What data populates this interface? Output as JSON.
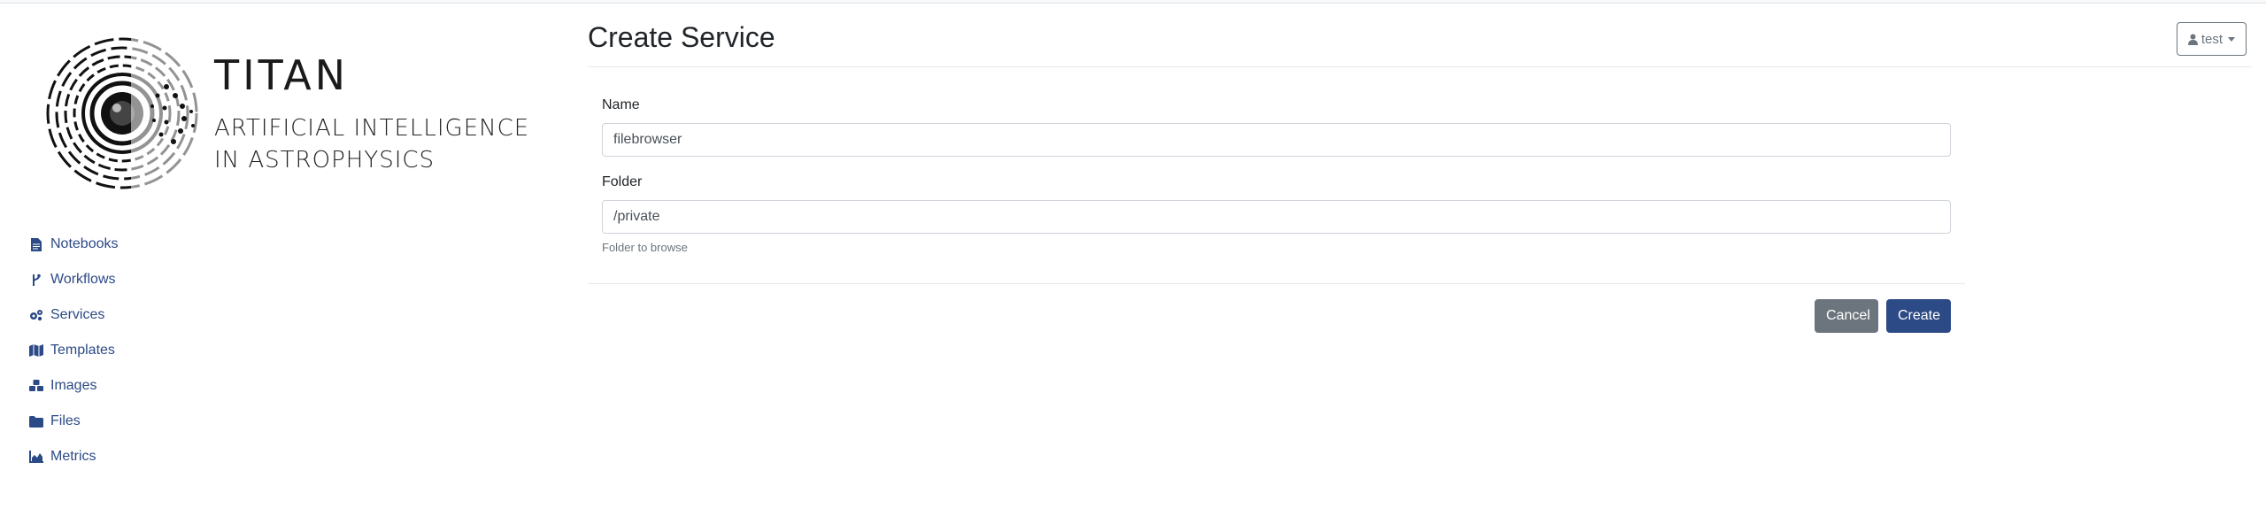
{
  "logo": {
    "title": "TITAN",
    "subtitle_line1": "ARTIFICIAL INTELLIGENCE",
    "subtitle_line2": "IN ASTROPHYSICS"
  },
  "sidebar": {
    "items": [
      {
        "label": "Notebooks",
        "icon": "file-icon"
      },
      {
        "label": "Workflows",
        "icon": "branch-icon"
      },
      {
        "label": "Services",
        "icon": "cogs-icon"
      },
      {
        "label": "Templates",
        "icon": "map-icon"
      },
      {
        "label": "Images",
        "icon": "cubes-icon"
      },
      {
        "label": "Files",
        "icon": "folder-icon"
      },
      {
        "label": "Metrics",
        "icon": "area-chart-icon"
      }
    ]
  },
  "header": {
    "title": "Create Service",
    "user_label": "test"
  },
  "form": {
    "name_label": "Name",
    "name_value": "filebrowser",
    "folder_label": "Folder",
    "folder_value": "/private",
    "folder_help": "Folder to browse",
    "cancel_label": "Cancel",
    "create_label": "Create"
  },
  "colors": {
    "primary": "#2c4a86",
    "secondary": "#6c757d",
    "link": "#2c4a86"
  }
}
